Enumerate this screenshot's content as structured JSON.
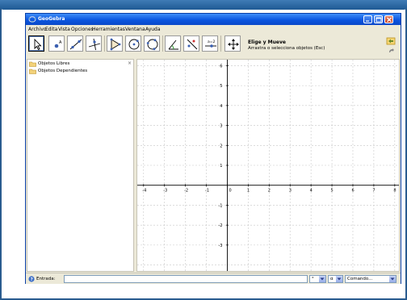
{
  "window": {
    "title": "GeoGebra"
  },
  "menu": {
    "items": [
      "Archivo",
      "Edita",
      "Vista",
      "Opciones",
      "Herramientas",
      "Ventana",
      "Ayuda"
    ]
  },
  "toolbar": {
    "tools": [
      {
        "icon": "move-arrow-icon",
        "selected": true
      },
      {
        "icon": "new-point-icon",
        "selected": false
      },
      {
        "icon": "line-through-two-points-icon",
        "selected": false
      },
      {
        "icon": "perpendicular-line-icon",
        "selected": false
      },
      {
        "icon": "polygon-icon",
        "selected": false
      },
      {
        "icon": "circle-center-point-icon",
        "selected": false
      },
      {
        "icon": "circle-three-points-icon",
        "selected": false
      },
      {
        "icon": "angle-icon",
        "selected": false
      },
      {
        "icon": "reflect-icon",
        "selected": false
      },
      {
        "icon": "slider-icon",
        "selected": false
      },
      {
        "icon": "move-view-icon",
        "selected": false
      }
    ],
    "selected_tool_name": "Elige y Mueve",
    "selected_tool_help": "Arrastra o selecciona objetos (Esc)"
  },
  "algebra": {
    "items": [
      "Objetos Libres",
      "Objetos Dependientes"
    ]
  },
  "graphics": {
    "x_ticks": [
      -4,
      -3,
      -2,
      -1,
      0,
      1,
      2,
      3,
      4,
      5,
      6,
      7,
      8
    ],
    "y_ticks": [
      6,
      5,
      4,
      3,
      2,
      1,
      0,
      -1,
      -2,
      -3
    ],
    "x_range": [
      -4.3,
      8.2
    ],
    "y_range": [
      -4.3,
      6.3
    ],
    "grid": true,
    "axis_color": "#000000",
    "grid_color": "#c8c8c8"
  },
  "input_bar": {
    "label": "Entrada:",
    "value": "",
    "symbol_combo": "°",
    "greek_combo": "α",
    "command_combo": "Comando..."
  }
}
